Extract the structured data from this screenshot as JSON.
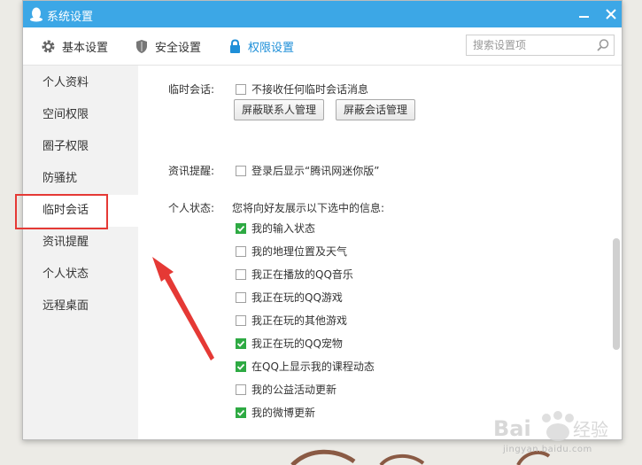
{
  "window": {
    "title": "系统设置"
  },
  "toolbar": {
    "tabs": [
      {
        "label": "基本设置",
        "icon": "gear-icon"
      },
      {
        "label": "安全设置",
        "icon": "shield-icon"
      },
      {
        "label": "权限设置",
        "icon": "lock-icon",
        "active": true
      }
    ],
    "search_placeholder": "搜索设置项"
  },
  "sidebar": {
    "items": [
      {
        "label": "个人资料"
      },
      {
        "label": "空间权限"
      },
      {
        "label": "圈子权限"
      },
      {
        "label": "防骚扰"
      },
      {
        "label": "临时会话",
        "active": true
      },
      {
        "label": "资讯提醒"
      },
      {
        "label": "个人状态"
      },
      {
        "label": "远程桌面"
      }
    ]
  },
  "temp_session": {
    "label": "临时会话:",
    "checkbox": "不接收任何临时会话消息",
    "checked": false,
    "buttons": [
      "屏蔽联系人管理",
      "屏蔽会话管理"
    ]
  },
  "news": {
    "label": "资讯提醒:",
    "checkbox": "登录后显示“腾讯网迷你版”",
    "checked": false
  },
  "status": {
    "label": "个人状态:",
    "intro": "您将向好友展示以下选中的信息:",
    "options": [
      {
        "label": "我的输入状态",
        "checked": true
      },
      {
        "label": "我的地理位置及天气",
        "checked": false
      },
      {
        "label": "我正在播放的QQ音乐",
        "checked": false
      },
      {
        "label": "我正在玩的QQ游戏",
        "checked": false
      },
      {
        "label": "我正在玩的其他游戏",
        "checked": false
      },
      {
        "label": "我正在玩的QQ宠物",
        "checked": true
      },
      {
        "label": "在QQ上显示我的课程动态",
        "checked": true
      },
      {
        "label": "我的公益活动更新",
        "checked": false
      },
      {
        "label": "我的微博更新",
        "checked": true
      }
    ]
  },
  "watermark": {
    "text": "Baidu经验",
    "url": "jingyan.baidu.com"
  },
  "colors": {
    "titlebar": "#3ca7e6",
    "accent": "#1e8fd8",
    "check": "#2eaa43",
    "annotation": "#e53935"
  }
}
